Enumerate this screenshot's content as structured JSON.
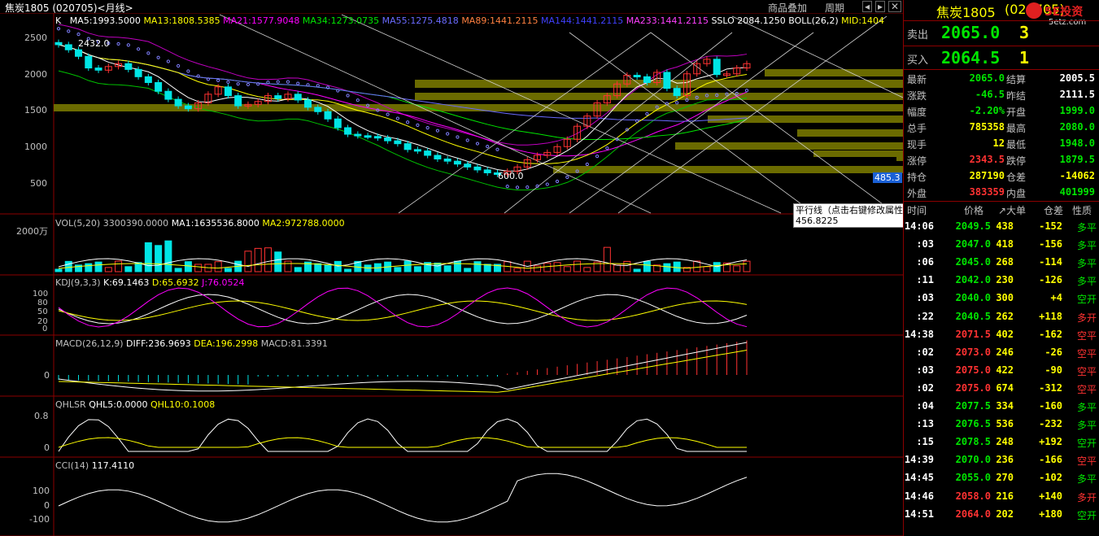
{
  "toolbar": {
    "title": "焦炭1805 (020705)<月线>",
    "overlay_label": "商品叠加",
    "period_label": "周期",
    "nav_prev": "◂",
    "nav_next": "▸",
    "nav_close": "✕"
  },
  "watermark": {
    "text": "5E投资",
    "url": "5etz.com"
  },
  "main_panel": {
    "k_label": "K",
    "ma5": "MA5:1993.5000",
    "ma13": "MA13:1808.5385",
    "ma21": "MA21:1577.9048",
    "ma34": "MA34:1273.0735",
    "ma55": "MA55:1275.4818",
    "ma89": "MA89:1441.2115",
    "ma144": "MA144:1441.2115",
    "ma233": "MA233:1441.2115",
    "sslo": "SSLO",
    "sslo_val": "2084.1250",
    "boll": "BOLL(26,2)",
    "mid": "MID:1404",
    "y_labels": [
      "2500",
      "2000",
      "1500",
      "1000",
      "500"
    ],
    "high_mark": "2432.0",
    "low_mark": "600.0",
    "price_tag": "485.3",
    "tooltip_title": "平行线（点击右键修改属性）",
    "tooltip_value": "456.8225"
  },
  "vol_panel": {
    "label": "VOL(5,20)",
    "value": "3300390.0000",
    "ma1": "MA1:1635536.8000",
    "ma2": "MA2:972788.0000",
    "y_label": "2000万"
  },
  "kdj_panel": {
    "label": "KDJ(9,3,3)",
    "k": "K:69.1463",
    "d": "D:65.6932",
    "j": "J:76.0524",
    "y_labels": [
      "100",
      "80",
      "50",
      "20",
      "0"
    ]
  },
  "macd_panel": {
    "label": "MACD(26,12,9)",
    "diff": "DIFF:236.9693",
    "dea": "DEA:196.2998",
    "macd": "MACD:81.3391",
    "y_label": "0"
  },
  "qhlsr_panel": {
    "label": "QHLSR",
    "qhl5": "QHL5:0.0000",
    "qhl10": "QHL10:0.1008",
    "y_labels": [
      "0.8",
      "0"
    ]
  },
  "cci_panel": {
    "label": "CCI(14)",
    "value": "117.4110",
    "y_labels": [
      "100",
      "0",
      "-100"
    ]
  },
  "quote": {
    "title": "焦炭1805",
    "code": "(020705)",
    "sell_label": "卖出",
    "sell_price": "2065.0",
    "sell_vol": "3",
    "buy_label": "买入",
    "buy_price": "2064.5",
    "buy_vol": "1",
    "rows": [
      {
        "l1": "最新",
        "v1": "2065.0",
        "c1": "grn",
        "l2": "结算",
        "v2": "2005.5",
        "c2": "wht"
      },
      {
        "l1": "涨跌",
        "v1": "-46.5",
        "c1": "grn",
        "l2": "昨结",
        "v2": "2111.5",
        "c2": "wht"
      },
      {
        "l1": "幅度",
        "v1": "-2.20%",
        "c1": "grn",
        "l2": "开盘",
        "v2": "1999.0",
        "c2": "grn"
      },
      {
        "l1": "总手",
        "v1": "785358",
        "c1": "yel",
        "l2": "最高",
        "v2": "2080.0",
        "c2": "grn"
      },
      {
        "l1": "现手",
        "v1": "12",
        "c1": "yel",
        "l2": "最低",
        "v2": "1948.0",
        "c2": "grn"
      },
      {
        "l1": "涨停",
        "v1": "2343.5",
        "c1": "red",
        "l2": "跌停",
        "v2": "1879.5",
        "c2": "grn"
      },
      {
        "l1": "持仓",
        "v1": "287190",
        "c1": "yel",
        "l2": "仓差",
        "v2": "-14062",
        "c2": "yel"
      },
      {
        "l1": "外盘",
        "v1": "383359",
        "c1": "red",
        "l2": "内盘",
        "v2": "401999",
        "c2": "grn"
      }
    ]
  },
  "ticks": {
    "headers": {
      "time": "时间",
      "price": "价格",
      "vol": "↗大单",
      "oi": "仓差",
      "nature": "性质"
    },
    "rows": [
      {
        "time": "14:06",
        "price": "2049.5",
        "pc": "grn",
        "vol": "438",
        "oi": "-152",
        "nature": "多平",
        "nc": "grn"
      },
      {
        "time": ":03",
        "price": "2047.0",
        "pc": "grn",
        "vol": "418",
        "oi": "-156",
        "nature": "多平",
        "nc": "grn"
      },
      {
        "time": ":06",
        "price": "2045.0",
        "pc": "grn",
        "vol": "268",
        "oi": "-114",
        "nature": "多平",
        "nc": "grn"
      },
      {
        "time": ":11",
        "price": "2042.0",
        "pc": "grn",
        "vol": "230",
        "oi": "-126",
        "nature": "多平",
        "nc": "grn"
      },
      {
        "time": ":03",
        "price": "2040.0",
        "pc": "grn",
        "vol": "300",
        "oi": "+4",
        "nature": "空开",
        "nc": "grn"
      },
      {
        "time": ":22",
        "price": "2040.5",
        "pc": "grn",
        "vol": "262",
        "oi": "+118",
        "nature": "多开",
        "nc": "red"
      },
      {
        "time": "14:38",
        "price": "2071.5",
        "pc": "red",
        "vol": "402",
        "oi": "-162",
        "nature": "空平",
        "nc": "red"
      },
      {
        "time": ":02",
        "price": "2073.0",
        "pc": "red",
        "vol": "246",
        "oi": "-26",
        "nature": "空平",
        "nc": "red"
      },
      {
        "time": ":03",
        "price": "2075.0",
        "pc": "red",
        "vol": "422",
        "oi": "-90",
        "nature": "空平",
        "nc": "red"
      },
      {
        "time": ":02",
        "price": "2075.0",
        "pc": "red",
        "vol": "674",
        "oi": "-312",
        "nature": "空平",
        "nc": "red"
      },
      {
        "time": ":04",
        "price": "2077.5",
        "pc": "grn",
        "vol": "334",
        "oi": "-160",
        "nature": "多平",
        "nc": "grn"
      },
      {
        "time": ":13",
        "price": "2076.5",
        "pc": "grn",
        "vol": "536",
        "oi": "-232",
        "nature": "多平",
        "nc": "grn"
      },
      {
        "time": ":15",
        "price": "2078.5",
        "pc": "grn",
        "vol": "248",
        "oi": "+192",
        "nature": "空开",
        "nc": "grn"
      },
      {
        "time": "14:39",
        "price": "2070.0",
        "pc": "grn",
        "vol": "236",
        "oi": "-166",
        "nature": "空平",
        "nc": "red"
      },
      {
        "time": "14:45",
        "price": "2055.0",
        "pc": "grn",
        "vol": "270",
        "oi": "-102",
        "nature": "多平",
        "nc": "grn"
      },
      {
        "time": "14:46",
        "price": "2058.0",
        "pc": "red",
        "vol": "216",
        "oi": "+140",
        "nature": "多开",
        "nc": "red"
      },
      {
        "time": "14:51",
        "price": "2064.0",
        "pc": "red",
        "vol": "202",
        "oi": "+180",
        "nature": "空开",
        "nc": "grn"
      }
    ]
  },
  "colors": {
    "grid": "#8b0000",
    "up": "#ff3232",
    "down": "#00e5e5",
    "ma5": "#ffffff",
    "ma13": "#ffff00",
    "ma21": "#ff00ff",
    "ma34": "#00e600",
    "ma55": "#6a6aff",
    "ma89": "#ff8040",
    "band": "#6b6b00"
  }
}
